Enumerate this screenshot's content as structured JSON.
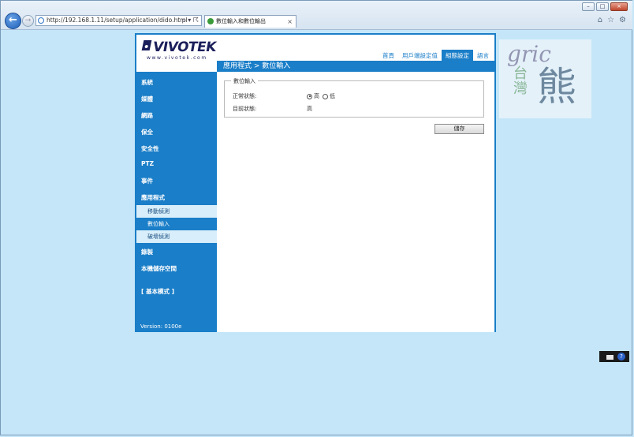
{
  "browser": {
    "url": "http://192.168.1.11/setup/application/dido.html",
    "tab_title": "數位輸入和數位輸出",
    "tab_close": "×",
    "address_tools": "ρ ▾ ☈",
    "window_controls": {
      "minimize": "–",
      "maximize": "□",
      "close": "×"
    },
    "back_icon": "←",
    "forward_icon": "→",
    "right_icons": {
      "home": "⌂",
      "favorites": "☆",
      "settings": "⚙"
    }
  },
  "page": {
    "logo_text": "VIVOTEK",
    "logo_url": "www.vivotek.com",
    "top_nav": [
      {
        "label": "首頁",
        "active": false
      },
      {
        "label": "用戶端設定值",
        "active": false
      },
      {
        "label": "組態設定",
        "active": true
      },
      {
        "label": "語言",
        "active": false
      }
    ],
    "breadcrumb": "應用程式 > 數位輸入",
    "sidebar": {
      "items": [
        {
          "label": "系統"
        },
        {
          "label": "媒體"
        },
        {
          "label": "網路"
        },
        {
          "label": "保全"
        },
        {
          "label": "安全性"
        },
        {
          "label": "PTZ"
        },
        {
          "label": "事件"
        },
        {
          "label": "應用程式"
        }
      ],
      "sub_items": [
        {
          "label": "移動偵測"
        },
        {
          "label": "數位輸入"
        },
        {
          "label": "破壞偵測"
        }
      ],
      "items_after": [
        {
          "label": "錄製"
        },
        {
          "label": "本機儲存空間"
        }
      ],
      "basic_mode": "[ 基本模式 ]",
      "version": "Version: 0100e"
    },
    "digital_input": {
      "legend": "數位輸入",
      "normal_state_label": "正常狀態:",
      "option_high": "高",
      "option_low": "低",
      "selected": "high",
      "current_state_label": "目前狀態:",
      "current_state_value": "高"
    },
    "save_label": "儲存"
  },
  "watermark": {
    "text": "gric",
    "chinese_1": "台灣",
    "chinese_2": "熊"
  },
  "tray": {
    "help": "?"
  }
}
